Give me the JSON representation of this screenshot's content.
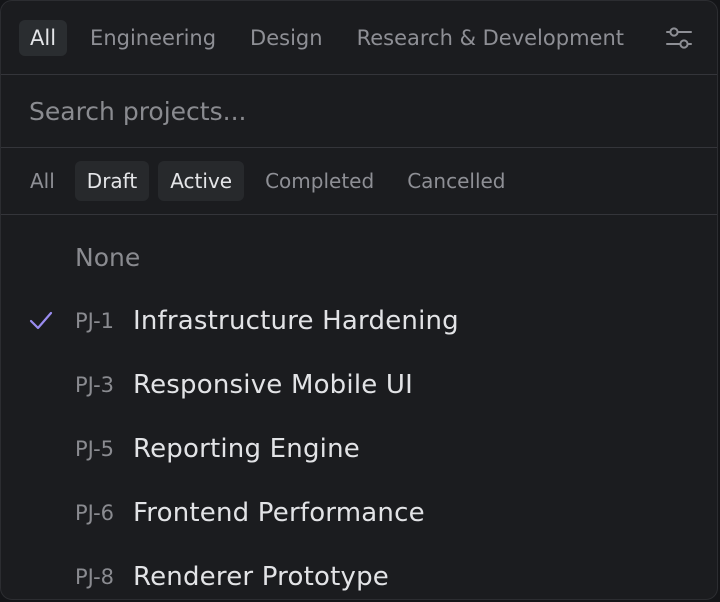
{
  "team_tabs": [
    {
      "label": "All",
      "active": true
    },
    {
      "label": "Engineering",
      "active": false
    },
    {
      "label": "Design",
      "active": false
    },
    {
      "label": "Research & Development",
      "active": false
    }
  ],
  "filter_icon": "sliders-icon",
  "search": {
    "placeholder": "Search projects...",
    "value": ""
  },
  "status_tabs": [
    {
      "label": "All",
      "selected": false
    },
    {
      "label": "Draft",
      "selected": true
    },
    {
      "label": "Active",
      "selected": true
    },
    {
      "label": "Completed",
      "selected": false
    },
    {
      "label": "Cancelled",
      "selected": false
    }
  ],
  "none_option": "None",
  "projects": [
    {
      "id": "PJ-1",
      "name": "Infrastructure Hardening",
      "checked": true
    },
    {
      "id": "PJ-3",
      "name": "Responsive Mobile UI",
      "checked": false
    },
    {
      "id": "PJ-5",
      "name": "Reporting Engine",
      "checked": false
    },
    {
      "id": "PJ-6",
      "name": "Frontend Performance",
      "checked": false
    },
    {
      "id": "PJ-8",
      "name": "Renderer Prototype",
      "checked": false
    }
  ],
  "colors": {
    "checkmark": "#9a8cf0",
    "background": "#1b1c1f"
  }
}
